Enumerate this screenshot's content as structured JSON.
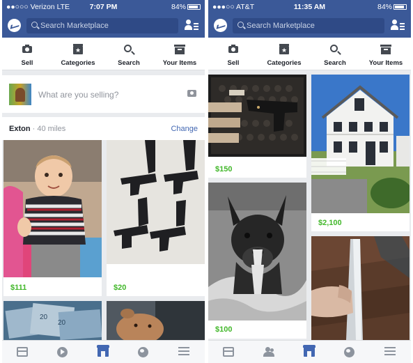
{
  "screens": [
    {
      "status": {
        "carrier": "●●○○○ Verizon  LTE",
        "time": "7:07 PM",
        "battery": "84%"
      },
      "search": {
        "placeholder": "Search Marketplace"
      },
      "actions": {
        "sell": "Sell",
        "categories": "Categories",
        "search": "Search",
        "your_items": "Your Items"
      },
      "sell_prompt": {
        "placeholder": "What are you selling?"
      },
      "location": {
        "city": "Exton",
        "distance": "· 40 miles",
        "change": "Change"
      },
      "listings": [
        {
          "price": "$111",
          "subject": "baby"
        },
        {
          "price": "$20",
          "subject": "pistols"
        },
        {
          "price": "",
          "subject": "cash"
        },
        {
          "price": "",
          "subject": "dog-in-car"
        }
      ]
    },
    {
      "status": {
        "carrier": "●●●○○ AT&T",
        "time": "11:35 AM",
        "battery": "84%"
      },
      "search": {
        "placeholder": "Search Marketplace"
      },
      "actions": {
        "sell": "Sell",
        "categories": "Categories",
        "search": "Search",
        "your_items": "Your Items"
      },
      "listings": [
        {
          "price": "$150",
          "subject": "pistol-case"
        },
        {
          "price": "$2,100",
          "subject": "house"
        },
        {
          "price": "$100",
          "subject": "pit-bull"
        },
        {
          "price": "",
          "subject": "phone"
        }
      ]
    }
  ],
  "colors": {
    "brand": "#3b5998",
    "price": "#42b72a",
    "link": "#4267b2"
  }
}
